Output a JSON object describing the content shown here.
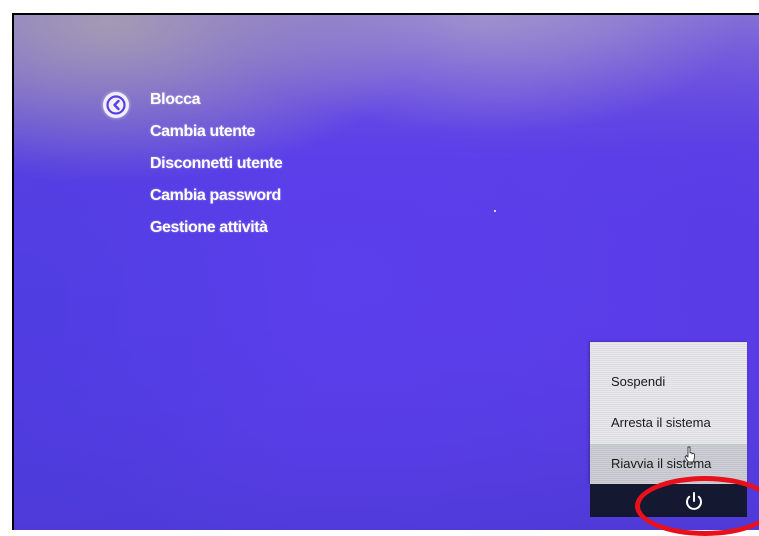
{
  "menu": {
    "items": [
      {
        "label": "Blocca"
      },
      {
        "label": "Cambia utente"
      },
      {
        "label": "Disconnetti utente"
      },
      {
        "label": "Cambia password"
      },
      {
        "label": "Gestione attività"
      }
    ]
  },
  "back_button": {
    "icon": "back-arrow-icon"
  },
  "power_menu": {
    "items": [
      {
        "label": "Sospendi"
      },
      {
        "label": "Arresta il sistema"
      },
      {
        "label": "Riavvia il sistema",
        "hovered": true
      }
    ],
    "power_icon": "power-icon"
  },
  "colors": {
    "background_accent": "#5a3ee6",
    "menu_text": "#ffffff",
    "power_menu_bg": "#e4e4e8",
    "power_bar_bg": "#141830",
    "highlight_ring": "#e8101a"
  }
}
